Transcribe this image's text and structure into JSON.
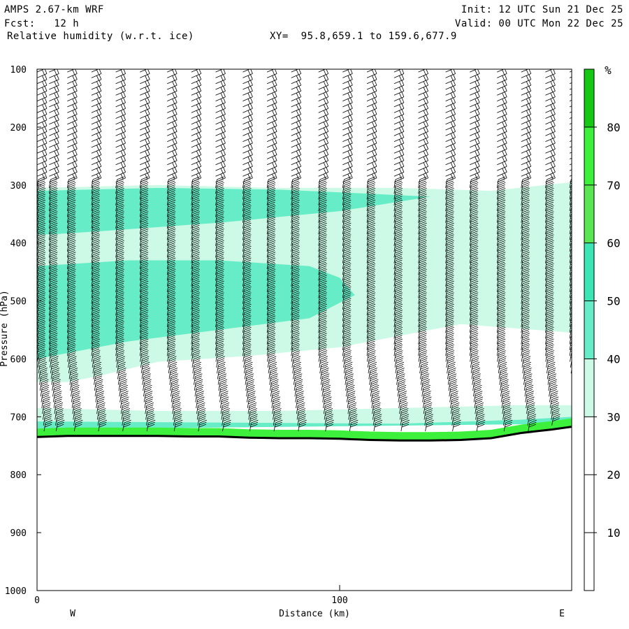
{
  "header": {
    "model": "AMPS 2.67-km WRF",
    "fcst": "Fcst:   12 h",
    "field": "Relative humidity (w.r.t. ice)",
    "xy": "XY=  95.8,659.1 to 159.6,677.9",
    "init": "Init: 12 UTC Sun 21 Dec 25",
    "valid": "Valid: 00 UTC Mon 22 Dec 25"
  },
  "chart_data": {
    "type": "heatmap",
    "title": "Relative humidity (w.r.t. ice)",
    "xlabel": "Distance (km)",
    "ylabel": "Pressure (hPa)",
    "xlim": [
      0,
      177
    ],
    "ylim": [
      1000,
      100
    ],
    "x_ticks": [
      0,
      100
    ],
    "y_ticks": [
      100,
      200,
      300,
      400,
      500,
      600,
      700,
      800,
      900,
      1000
    ],
    "x_end_labels": {
      "left": "W",
      "right": "E"
    },
    "colorbar": {
      "unit": "%",
      "levels": [
        0,
        10,
        20,
        30,
        40,
        50,
        60,
        70,
        80,
        90
      ],
      "tick_labels": [
        10,
        20,
        30,
        40,
        50,
        60,
        70,
        80
      ],
      "colors": [
        "#ffffff",
        "#ffffff",
        "#ffffff",
        "#ccfae6",
        "#66edc8",
        "#3ce6b4",
        "#5ae650",
        "#3cf03c",
        "#14c814"
      ]
    },
    "rh_regions": [
      {
        "level": 30,
        "label": "30-40%",
        "color": "#ccfae6",
        "outline": [
          [
            0,
            305
          ],
          [
            40,
            300
          ],
          [
            80,
            305
          ],
          [
            120,
            305
          ],
          [
            150,
            310
          ],
          [
            177,
            295
          ],
          [
            177,
            555
          ],
          [
            140,
            540
          ],
          [
            120,
            560
          ],
          [
            100,
            580
          ],
          [
            70,
            595
          ],
          [
            40,
            605
          ],
          [
            20,
            630
          ],
          [
            10,
            640
          ],
          [
            0,
            640
          ]
        ]
      },
      {
        "level": 40,
        "label": "40-50%",
        "color": "#66edc8",
        "outline": [
          [
            0,
            310
          ],
          [
            40,
            305
          ],
          [
            80,
            308
          ],
          [
            110,
            315
          ],
          [
            130,
            320
          ],
          [
            100,
            345
          ],
          [
            60,
            365
          ],
          [
            20,
            380
          ],
          [
            5,
            385
          ],
          [
            0,
            385
          ]
        ]
      },
      {
        "level": 40,
        "label": "40-50%",
        "color": "#66edc8",
        "outline": [
          [
            0,
            440
          ],
          [
            30,
            430
          ],
          [
            60,
            430
          ],
          [
            90,
            440
          ],
          [
            100,
            460
          ],
          [
            105,
            490
          ],
          [
            90,
            530
          ],
          [
            60,
            550
          ],
          [
            30,
            570
          ],
          [
            10,
            590
          ],
          [
            0,
            600
          ]
        ]
      },
      {
        "level": 30,
        "label": "30-40%",
        "color": "#ccfae6",
        "outline": [
          [
            0,
            685
          ],
          [
            40,
            690
          ],
          [
            80,
            690
          ],
          [
            120,
            685
          ],
          [
            160,
            680
          ],
          [
            177,
            680
          ],
          [
            177,
            712
          ],
          [
            0,
            722
          ]
        ]
      },
      {
        "level": 40,
        "label": "40-50%",
        "color": "#66edc8",
        "outline": [
          [
            0,
            708
          ],
          [
            60,
            710
          ],
          [
            120,
            712
          ],
          [
            160,
            705
          ],
          [
            177,
            700
          ],
          [
            177,
            712
          ],
          [
            0,
            722
          ]
        ]
      }
    ],
    "terrain_pressure": {
      "x": [
        0,
        10,
        20,
        30,
        40,
        50,
        60,
        70,
        80,
        90,
        100,
        110,
        120,
        130,
        140,
        150,
        160,
        170,
        177
      ],
      "p": [
        735,
        733,
        733,
        733,
        733,
        734,
        734,
        736,
        737,
        737,
        738,
        740,
        741,
        741,
        740,
        737,
        728,
        722,
        717
      ]
    },
    "wind_columns_x": [
      0,
      4,
      10,
      18,
      26,
      34,
      43,
      51,
      59,
      68,
      76,
      84,
      93,
      101,
      109,
      118,
      126,
      135,
      143,
      152,
      160,
      168,
      176
    ],
    "wind_barb_pressures": [
      105,
      115,
      125,
      135,
      145,
      155,
      165,
      175,
      185,
      195,
      205,
      215,
      225,
      235,
      245,
      255,
      265,
      275,
      285,
      295,
      305,
      315,
      325,
      335,
      345,
      355,
      365,
      375,
      385,
      395,
      405,
      415,
      425,
      435,
      445,
      455,
      465,
      475,
      485,
      495,
      505,
      515,
      525,
      535,
      545,
      555,
      565,
      575,
      585,
      595,
      605,
      615,
      625,
      635,
      645,
      655,
      665,
      675,
      685,
      695,
      705,
      715,
      725
    ]
  }
}
